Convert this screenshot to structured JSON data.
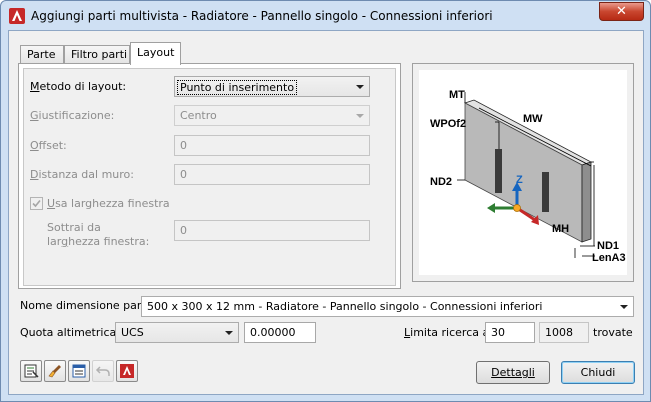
{
  "window": {
    "title": "Aggiungi parti multivista - Radiatore - Pannello singolo - Connessioni inferiori",
    "close_glyph": "✕"
  },
  "tabs": [
    {
      "label": "Parte",
      "active": false
    },
    {
      "label": "Filtro parti",
      "active": false
    },
    {
      "label": "Layout",
      "active": true
    }
  ],
  "layout": {
    "metodo": {
      "label_u": "M",
      "label_rest": "etodo di layout:",
      "value": "Punto di inserimento"
    },
    "giustificazione": {
      "label_u": "G",
      "label_rest": "iustificazione:",
      "value": "Centro"
    },
    "offset": {
      "label_u": "O",
      "label_rest": "ffset:",
      "value": "0"
    },
    "distanza": {
      "label_u": "D",
      "label_rest": "istanza dal muro:",
      "value": "0"
    },
    "usa_larghezza": {
      "label_u": "U",
      "label_rest": "sa larghezza finestra",
      "checked": true
    },
    "sottrai": {
      "label_line1": "Sottrai da",
      "label_pre": "lar",
      "label_u": "g",
      "label_post": "hezza finestra:",
      "value": "0"
    }
  },
  "preview": {
    "labels": {
      "mt": "MT",
      "mw": "MW",
      "wpof2": "WPOf2",
      "nd2": "ND2",
      "z": "Z",
      "mh": "MH",
      "nd1": "ND1",
      "lena3": "LenA3"
    }
  },
  "bottom": {
    "nome_label": "Nome dimensione parte:",
    "nome_value": "500 x 300 x 12 mm - Radiatore - Pannello singolo - Connessioni inferiori",
    "quota_label": "Quota altimetrica:",
    "quota_combo": "UCS",
    "quota_value": "0.00000",
    "limita_label_u": "L",
    "limita_label_rest": "imita ricerca a:",
    "limita_value": "30",
    "found_count": "1008",
    "found_label": "trovate"
  },
  "buttons": {
    "dettagli": "Dettagli",
    "chiudi": "Chiudi"
  },
  "toolbar_icons": [
    "catalog-icon",
    "paint-brush-icon",
    "properties-icon",
    "undo-icon",
    "help-icon"
  ],
  "colors": {
    "titlebar": "#cfe0f3",
    "close": "#c9462f",
    "accent_blue": "#3c7fb1"
  }
}
